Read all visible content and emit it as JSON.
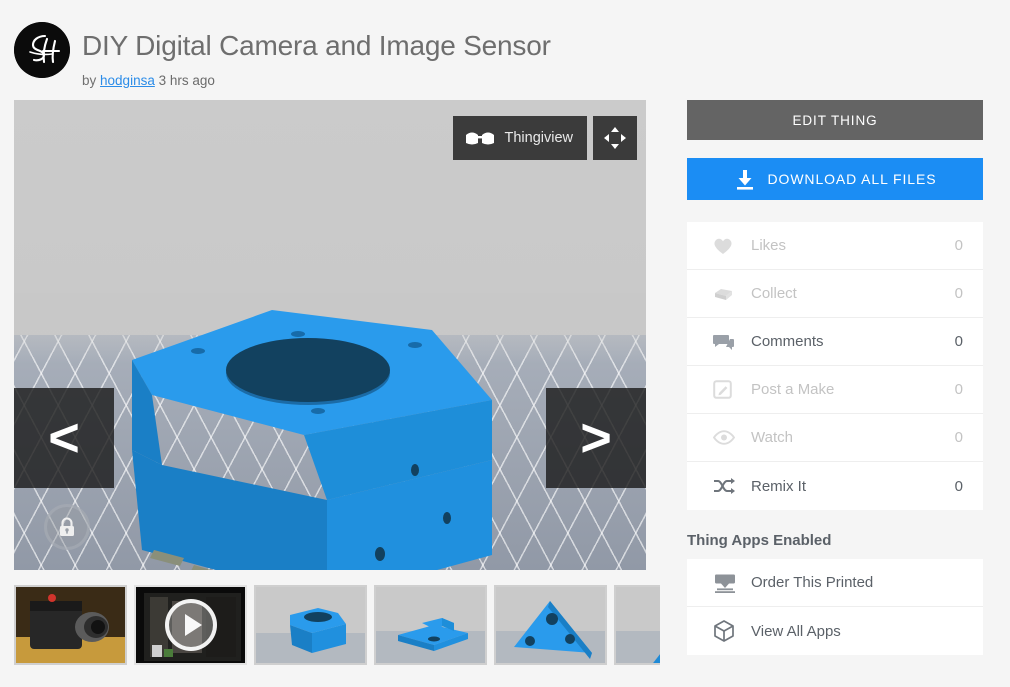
{
  "header": {
    "title": "DIY Digital Camera and Image Sensor",
    "by_prefix": "by",
    "author": "hodginsa",
    "time_ago": "3 hrs ago",
    "avatar_icon": "sh-monogram-avatar"
  },
  "viewer": {
    "thingiview_label": "Thingiview",
    "glasses_icon": "3d-glasses-icon",
    "fullscreen_icon": "fullscreen-expand-icon",
    "prev_label": "<",
    "next_label": ">",
    "lock_icon": "lock-icon",
    "background_color": "#c8c8c8",
    "model_color": "#1f8ad6"
  },
  "thumbnails": [
    {
      "name": "camera-photo-thumbnail",
      "type": "photo",
      "selected": false
    },
    {
      "name": "video-thumbnail",
      "type": "video",
      "selected": true
    },
    {
      "name": "render-box-thumbnail",
      "type": "render",
      "selected": false
    },
    {
      "name": "render-base-thumbnail",
      "type": "render",
      "selected": false
    },
    {
      "name": "render-triangle-thumbnail",
      "type": "render",
      "selected": false
    },
    {
      "name": "render-partial-thumbnail",
      "type": "render",
      "selected": false
    }
  ],
  "sidebar": {
    "edit_label": "EDIT THING",
    "download_label": "DOWNLOAD ALL FILES",
    "download_icon": "download-icon",
    "stats": [
      {
        "label": "Likes",
        "count": "0",
        "icon": "heart-icon",
        "state": "dim"
      },
      {
        "label": "Collect",
        "count": "0",
        "icon": "collection-icon",
        "state": "dim"
      },
      {
        "label": "Comments",
        "count": "0",
        "icon": "comment-icon",
        "state": "on"
      },
      {
        "label": "Post a Make",
        "count": "0",
        "icon": "edit-square-icon",
        "state": "dim"
      },
      {
        "label": "Watch",
        "count": "0",
        "icon": "eye-icon",
        "state": "dim"
      },
      {
        "label": "Remix It",
        "count": "0",
        "icon": "shuffle-icon",
        "state": "on"
      }
    ],
    "apps_title": "Thing Apps Enabled",
    "apps": [
      {
        "label": "Order This Printed",
        "icon": "printer-order-icon"
      },
      {
        "label": "View All Apps",
        "icon": "cube-icon"
      }
    ]
  },
  "colors": {
    "page_bg": "#f5f5f5",
    "accent_blue": "#1b8df4",
    "edit_gray": "#646464",
    "link_blue": "#2b8ce8",
    "title_gray": "#6e6e6e"
  }
}
